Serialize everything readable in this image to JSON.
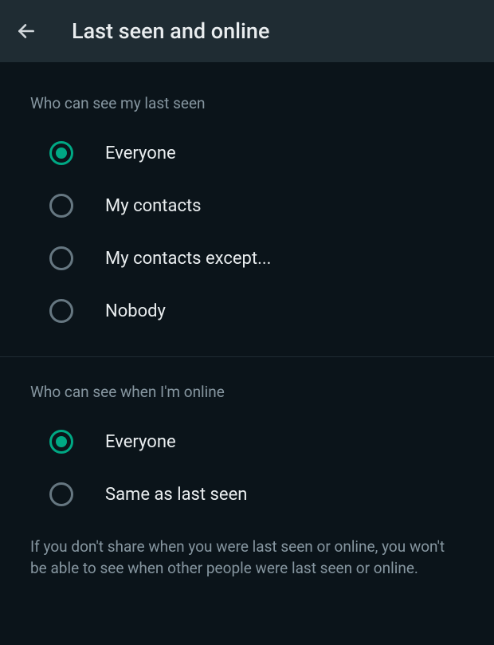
{
  "header": {
    "title": "Last seen and online"
  },
  "lastSeen": {
    "title": "Who can see my last seen",
    "options": [
      {
        "label": "Everyone",
        "selected": true
      },
      {
        "label": "My contacts",
        "selected": false
      },
      {
        "label": "My contacts except...",
        "selected": false
      },
      {
        "label": "Nobody",
        "selected": false
      }
    ]
  },
  "online": {
    "title": "Who can see when I'm online",
    "options": [
      {
        "label": "Everyone",
        "selected": true
      },
      {
        "label": "Same as last seen",
        "selected": false
      }
    ]
  },
  "footer": "If you don't share when you were last seen or online, you won't be able to see when other people were last seen or online."
}
